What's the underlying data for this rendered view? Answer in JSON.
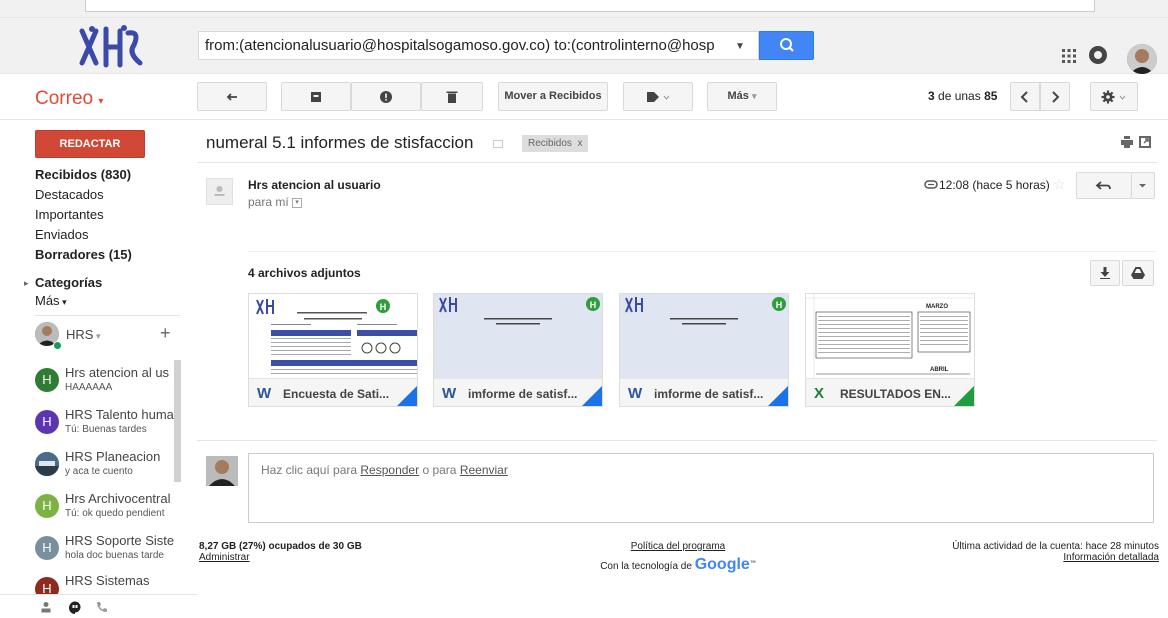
{
  "header": {
    "search_query": "from:(atencionalusuario@hospitalsogamoso.gov.co) to:(controlinterno@hosp",
    "search_icon": "search-icon",
    "apps_icon": "apps-grid-icon",
    "notifications_icon": "notifications-icon",
    "logo_text": "HRS"
  },
  "toolbar": {
    "app_label": "Correo",
    "move_inbox": "Mover a Recibidos",
    "more": "Más",
    "count_current": "3",
    "count_text": "de unas",
    "count_total": "85"
  },
  "sidebar": {
    "compose": "REDACTAR",
    "nav": [
      {
        "label": "Recibidos (830)",
        "bold": true
      },
      {
        "label": "Destacados",
        "bold": false
      },
      {
        "label": "Importantes",
        "bold": false
      },
      {
        "label": "Enviados",
        "bold": false
      },
      {
        "label": "Borradores (15)",
        "bold": true
      },
      {
        "label": "Categorías",
        "bold": true
      },
      {
        "label": "Más",
        "bold": false
      }
    ],
    "account": "HRS",
    "contacts": [
      {
        "initial": "H",
        "name": "Hrs atencion al us",
        "msg": "HAAAAAA",
        "color": "#2e7d32"
      },
      {
        "initial": "H",
        "name": "HRS Talento huma",
        "msg": "Tú: Buenas tardes",
        "color": "#5e35b1"
      },
      {
        "initial": "",
        "name": "HRS Planeacion",
        "msg": "y aca te cuento",
        "color": "#37474f"
      },
      {
        "initial": "H",
        "name": "Hrs Archivocentral",
        "msg": "Tú: ok quedo pendient",
        "color": "#7cb342"
      },
      {
        "initial": "H",
        "name": "HRS Soporte Siste",
        "msg": "hola doc buenas tarde",
        "color": "#78909c"
      },
      {
        "initial": "H",
        "name": "HRS Sistemas",
        "msg": "",
        "color": "#8d2b1f"
      }
    ]
  },
  "message": {
    "subject": "numeral 5.1 informes de stisfaccion",
    "label": "Recibidos",
    "label_close": "x",
    "sender": "Hrs atencion al usuario",
    "to": "para mí",
    "time": "12:08 (hace 5 horas)",
    "attachments_title": "4 archivos adjuntos",
    "attachments": [
      {
        "icon": "W",
        "name": "Encuesta de Sati...",
        "icon_color": "#2b5797",
        "corner_color": "#1a73e8"
      },
      {
        "icon": "W",
        "name": "imforme de satisf...",
        "icon_color": "#2b5797",
        "corner_color": "#1a73e8"
      },
      {
        "icon": "W",
        "name": "imforme de satisf...",
        "icon_color": "#2b5797",
        "corner_color": "#1a73e8"
      },
      {
        "icon": "X",
        "name": "RESULTADOS EN...",
        "icon_color": "#1e7e34",
        "corner_color": "#1e9e3e"
      }
    ],
    "thumb_sheet_title": "MARZO",
    "thumb_sheet_footer": "ABRIL"
  },
  "reply": {
    "prefix": "Haz clic aquí para ",
    "reply_link": "Responder",
    "middle": " o para ",
    "forward_link": "Reenviar"
  },
  "footer": {
    "storage": "8,27 GB (27%) ocupados de 30 GB",
    "manage": "Administrar",
    "policy": "Política del programa",
    "powered": "Con la tecnología de",
    "google": "Google",
    "activity": "Última actividad de la cuenta: hace 28 minutos",
    "details": "Información detallada"
  }
}
